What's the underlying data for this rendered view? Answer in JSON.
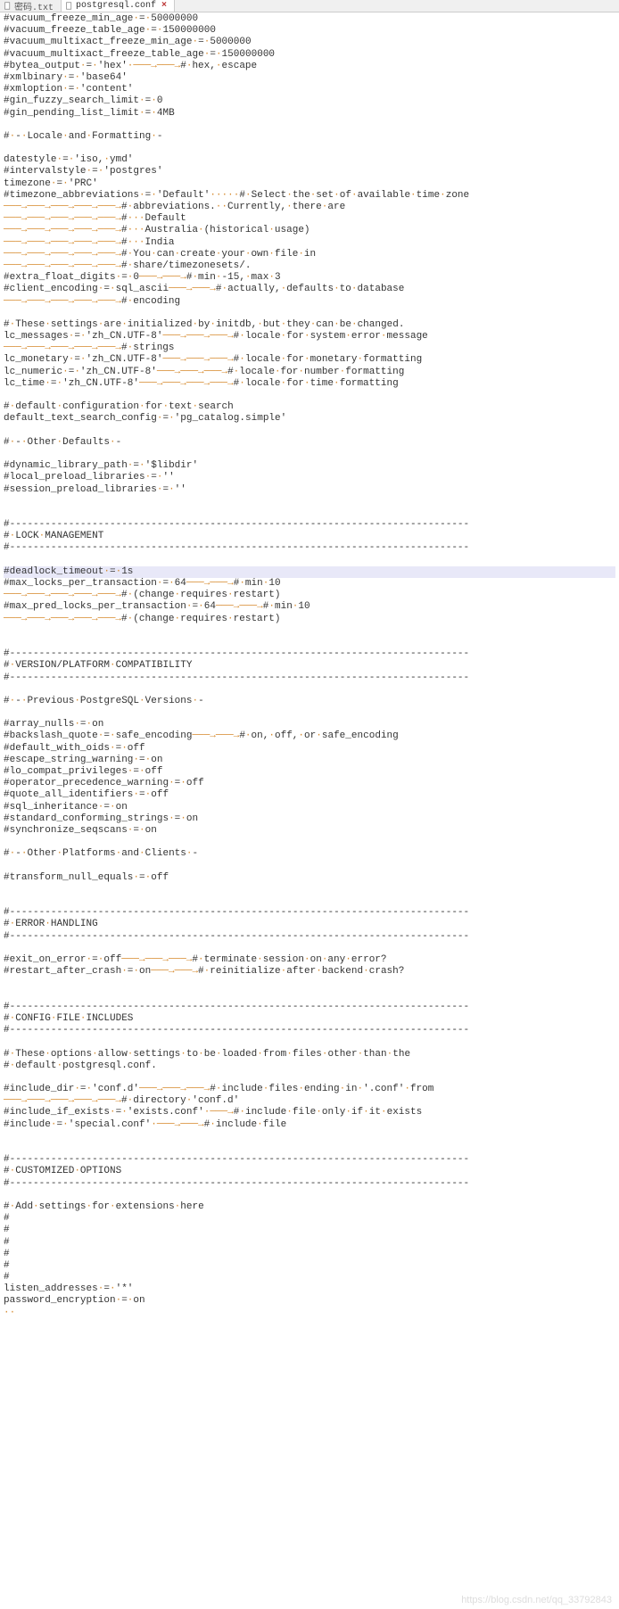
{
  "tabs": [
    {
      "label": "密码.txt",
      "icon": "file-icon",
      "active": false
    },
    {
      "label": "postgresql.conf",
      "icon": "file-icon",
      "active": true,
      "closable": true
    }
  ],
  "watermark": "https://blog.csdn.net/qq_33792843",
  "lines": [
    {
      "t": "#vacuum_freeze_min_age·=·50000000"
    },
    {
      "t": "#vacuum_freeze_table_age·=·150000000"
    },
    {
      "t": "#vacuum_multixact_freeze_min_age·=·5000000"
    },
    {
      "t": "#vacuum_multixact_freeze_table_age·=·150000000"
    },
    {
      "t": "#bytea_output·=·'hex'·→──→#·hex,·escape"
    },
    {
      "t": "#xmlbinary·=·'base64'"
    },
    {
      "t": "#xmloption·=·'content'"
    },
    {
      "t": "#gin_fuzzy_search_limit·=·0"
    },
    {
      "t": "#gin_pending_list_limit·=·4MB"
    },
    {
      "t": ""
    },
    {
      "t": "#·-·Locale·and·Formatting·-"
    },
    {
      "t": ""
    },
    {
      "t": "datestyle·=·'iso,·ymd'"
    },
    {
      "t": "#intervalstyle·=·'postgres'"
    },
    {
      "t": "timezone·=·'PRC'"
    },
    {
      "t": "#timezone_abbreviations·=·'Default'·····#·Select·the·set·of·available·time·zone"
    },
    {
      "t": "→──→──→──→──→#·abbreviations.··Currently,·there·are"
    },
    {
      "t": "→──→──→──→──→#···Default"
    },
    {
      "t": "→──→──→──→──→#···Australia·(historical·usage)"
    },
    {
      "t": "→──→──→──→──→#···India"
    },
    {
      "t": "→──→──→──→──→#·You·can·create·your·own·file·in"
    },
    {
      "t": "→──→──→──→──→#·share/timezonesets/."
    },
    {
      "t": "#extra_float_digits·=·0→──→#·min·-15,·max·3"
    },
    {
      "t": "#client_encoding·=·sql_ascii→──→#·actually,·defaults·to·database"
    },
    {
      "t": "→──→──→──→──→#·encoding"
    },
    {
      "t": ""
    },
    {
      "t": "#·These·settings·are·initialized·by·initdb,·but·they·can·be·changed."
    },
    {
      "t": "lc_messages·=·'zh_CN.UTF-8'→──→──→#·locale·for·system·error·message"
    },
    {
      "t": "→──→──→──→──→#·strings"
    },
    {
      "t": "lc_monetary·=·'zh_CN.UTF-8'→──→──→#·locale·for·monetary·formatting"
    },
    {
      "t": "lc_numeric·=·'zh_CN.UTF-8'→──→──→#·locale·for·number·formatting"
    },
    {
      "t": "lc_time·=·'zh_CN.UTF-8'→──→──→──→#·locale·for·time·formatting"
    },
    {
      "t": ""
    },
    {
      "t": "#·default·configuration·for·text·search"
    },
    {
      "t": "default_text_search_config·=·'pg_catalog.simple'"
    },
    {
      "t": ""
    },
    {
      "t": "#·-·Other·Defaults·-"
    },
    {
      "t": ""
    },
    {
      "t": "#dynamic_library_path·=·'$libdir'"
    },
    {
      "t": "#local_preload_libraries·=·''"
    },
    {
      "t": "#session_preload_libraries·=·''"
    },
    {
      "t": ""
    },
    {
      "t": ""
    },
    {
      "t": "#------------------------------------------------------------------------------"
    },
    {
      "t": "#·LOCK·MANAGEMENT"
    },
    {
      "t": "#------------------------------------------------------------------------------"
    },
    {
      "t": ""
    },
    {
      "t": "#deadlock_timeout·=·1s",
      "hl": true
    },
    {
      "t": "#max_locks_per_transaction·=·64→──→#·min·10"
    },
    {
      "t": "→──→──→──→──→#·(change·requires·restart)"
    },
    {
      "t": "#max_pred_locks_per_transaction·=·64→──→#·min·10"
    },
    {
      "t": "→──→──→──→──→#·(change·requires·restart)"
    },
    {
      "t": ""
    },
    {
      "t": ""
    },
    {
      "t": "#------------------------------------------------------------------------------"
    },
    {
      "t": "#·VERSION/PLATFORM·COMPATIBILITY"
    },
    {
      "t": "#------------------------------------------------------------------------------"
    },
    {
      "t": ""
    },
    {
      "t": "#·-·Previous·PostgreSQL·Versions·-"
    },
    {
      "t": ""
    },
    {
      "t": "#array_nulls·=·on"
    },
    {
      "t": "#backslash_quote·=·safe_encoding→──→#·on,·off,·or·safe_encoding"
    },
    {
      "t": "#default_with_oids·=·off"
    },
    {
      "t": "#escape_string_warning·=·on"
    },
    {
      "t": "#lo_compat_privileges·=·off"
    },
    {
      "t": "#operator_precedence_warning·=·off"
    },
    {
      "t": "#quote_all_identifiers·=·off"
    },
    {
      "t": "#sql_inheritance·=·on"
    },
    {
      "t": "#standard_conforming_strings·=·on"
    },
    {
      "t": "#synchronize_seqscans·=·on"
    },
    {
      "t": ""
    },
    {
      "t": "#·-·Other·Platforms·and·Clients·-"
    },
    {
      "t": ""
    },
    {
      "t": "#transform_null_equals·=·off"
    },
    {
      "t": ""
    },
    {
      "t": ""
    },
    {
      "t": "#------------------------------------------------------------------------------"
    },
    {
      "t": "#·ERROR·HANDLING"
    },
    {
      "t": "#------------------------------------------------------------------------------"
    },
    {
      "t": ""
    },
    {
      "t": "#exit_on_error·=·off→──→──→#·terminate·session·on·any·error?"
    },
    {
      "t": "#restart_after_crash·=·on→──→#·reinitialize·after·backend·crash?"
    },
    {
      "t": ""
    },
    {
      "t": ""
    },
    {
      "t": "#------------------------------------------------------------------------------"
    },
    {
      "t": "#·CONFIG·FILE·INCLUDES"
    },
    {
      "t": "#------------------------------------------------------------------------------"
    },
    {
      "t": ""
    },
    {
      "t": "#·These·options·allow·settings·to·be·loaded·from·files·other·than·the"
    },
    {
      "t": "#·default·postgresql.conf."
    },
    {
      "t": ""
    },
    {
      "t": "#include_dir·=·'conf.d'→──→──→#·include·files·ending·in·'.conf'·from"
    },
    {
      "t": "→──→──→──→──→#·directory·'conf.d'"
    },
    {
      "t": "#include_if_exists·=·'exists.conf'·→#·include·file·only·if·it·exists"
    },
    {
      "t": "#include·=·'special.conf'·→──→#·include·file"
    },
    {
      "t": ""
    },
    {
      "t": ""
    },
    {
      "t": "#------------------------------------------------------------------------------"
    },
    {
      "t": "#·CUSTOMIZED·OPTIONS"
    },
    {
      "t": "#------------------------------------------------------------------------------"
    },
    {
      "t": ""
    },
    {
      "t": "#·Add·settings·for·extensions·here"
    },
    {
      "t": "#"
    },
    {
      "t": "#"
    },
    {
      "t": "#"
    },
    {
      "t": "#"
    },
    {
      "t": "#"
    },
    {
      "t": "#"
    },
    {
      "t": "listen_addresses·=·'*'"
    },
    {
      "t": "password_encryption·=·on"
    },
    {
      "t": "··"
    }
  ]
}
